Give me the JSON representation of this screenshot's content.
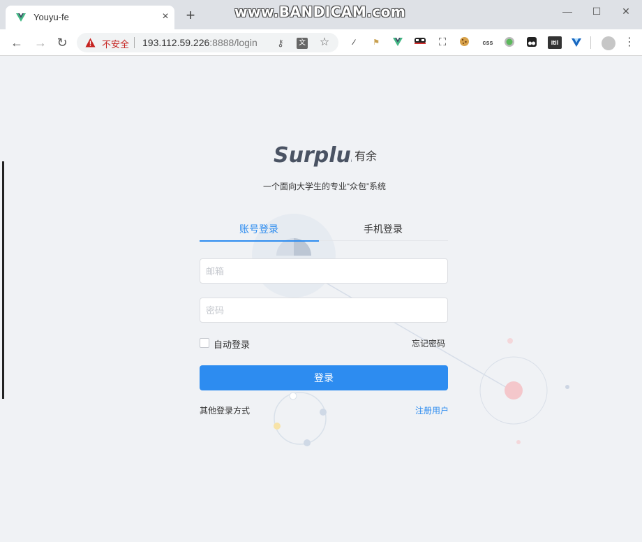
{
  "browser": {
    "tab_title": "Youyu-fe",
    "tab_close": "×",
    "new_tab": "+",
    "watermark": "www.BANDICAM.com",
    "security_label": "不安全",
    "url_host": "193.112.59.226",
    "url_rest": ":8888/login",
    "window_controls": {
      "minimize": "—",
      "maximize": "☐",
      "close": "✕"
    },
    "nav": {
      "back": "←",
      "forward": "→",
      "reload": "↻"
    },
    "omnibox_icons": [
      "key-icon",
      "translate-icon",
      "star-icon"
    ],
    "extensions": [
      "eyedropper-icon",
      "flag-icon",
      "vue-devtools-icon",
      "mask-icon",
      "screenshot-icon",
      "cookie-icon",
      "css-icon",
      "green-circle-icon",
      "tampermonkey-icon",
      "itil-icon",
      "vuetify-icon"
    ],
    "ext_css_label": "css",
    "ext_itil_label": "itil",
    "menu_label": "⋮"
  },
  "page": {
    "logo_text": "Surplus",
    "logo_suffix": "有余",
    "slogan": "一个面向大学生的专业“众包”系统",
    "tabs": [
      {
        "label": "账号登录",
        "active": true
      },
      {
        "label": "手机登录",
        "active": false
      }
    ],
    "email_placeholder": "邮箱",
    "password_placeholder": "密码",
    "remember_label": "自动登录",
    "forgot_label": "忘记密码",
    "submit_label": "登录",
    "other_login_label": "其他登录方式",
    "register_label": "注册用户"
  },
  "colors": {
    "accent": "#2d8cf0",
    "warning": "#c5221f",
    "vue_green": "#41b883"
  }
}
